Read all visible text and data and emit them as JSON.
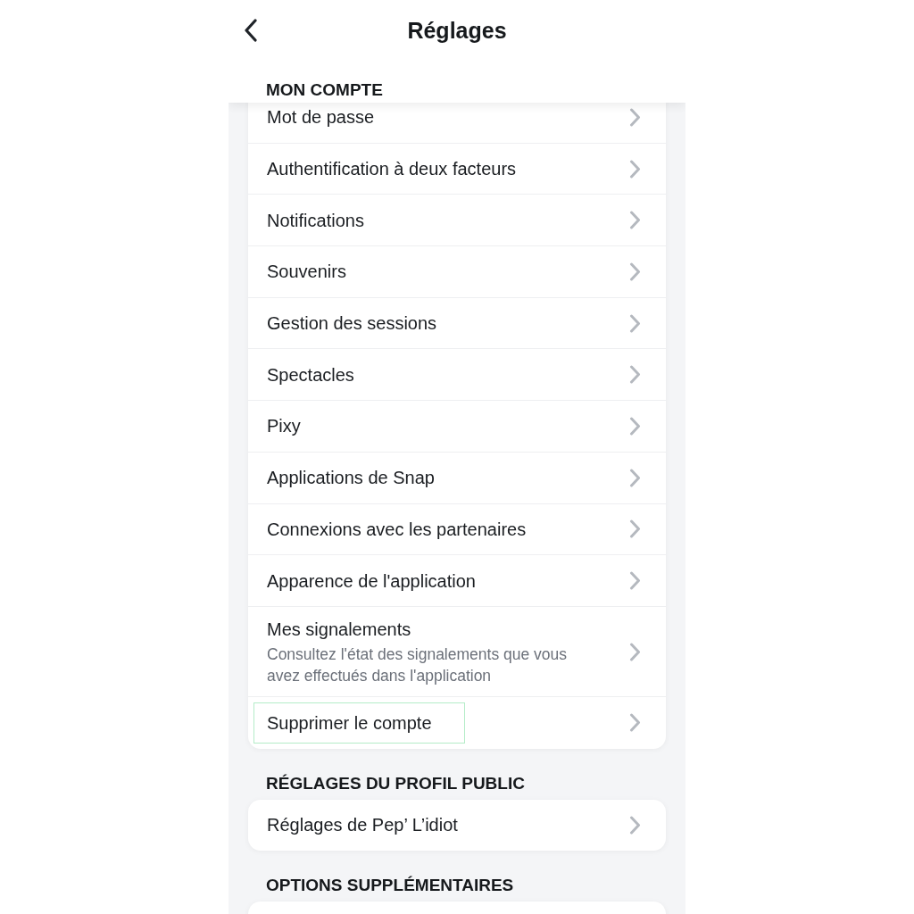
{
  "header": {
    "title": "Réglages"
  },
  "sections": [
    {
      "title": "MON COMPTE",
      "items": [
        {
          "label": "Mot de passe",
          "highlighted": false
        },
        {
          "label": "Authentification à deux facteurs",
          "highlighted": false
        },
        {
          "label": "Notifications",
          "highlighted": false
        },
        {
          "label": "Souvenirs",
          "highlighted": false
        },
        {
          "label": "Gestion des sessions",
          "highlighted": false
        },
        {
          "label": "Spectacles",
          "highlighted": false
        },
        {
          "label": "Pixy",
          "highlighted": false
        },
        {
          "label": "Applications de Snap",
          "highlighted": false
        },
        {
          "label": "Connexions avec les partenaires",
          "highlighted": false
        },
        {
          "label": "Apparence de l'application",
          "highlighted": false
        },
        {
          "label": "Mes signalements",
          "description": "Consultez l'état des signalements que vous avez effectués dans l'application",
          "highlighted": false
        },
        {
          "label": "Supprimer le compte",
          "highlighted": true
        }
      ]
    },
    {
      "title": "RÉGLAGES DU PROFIL PUBLIC",
      "items": [
        {
          "label": "Réglages de Pep’ L’idiot",
          "highlighted": false
        }
      ]
    },
    {
      "title": "OPTIONS SUPPLÉMENTAIRES"
    }
  ]
}
